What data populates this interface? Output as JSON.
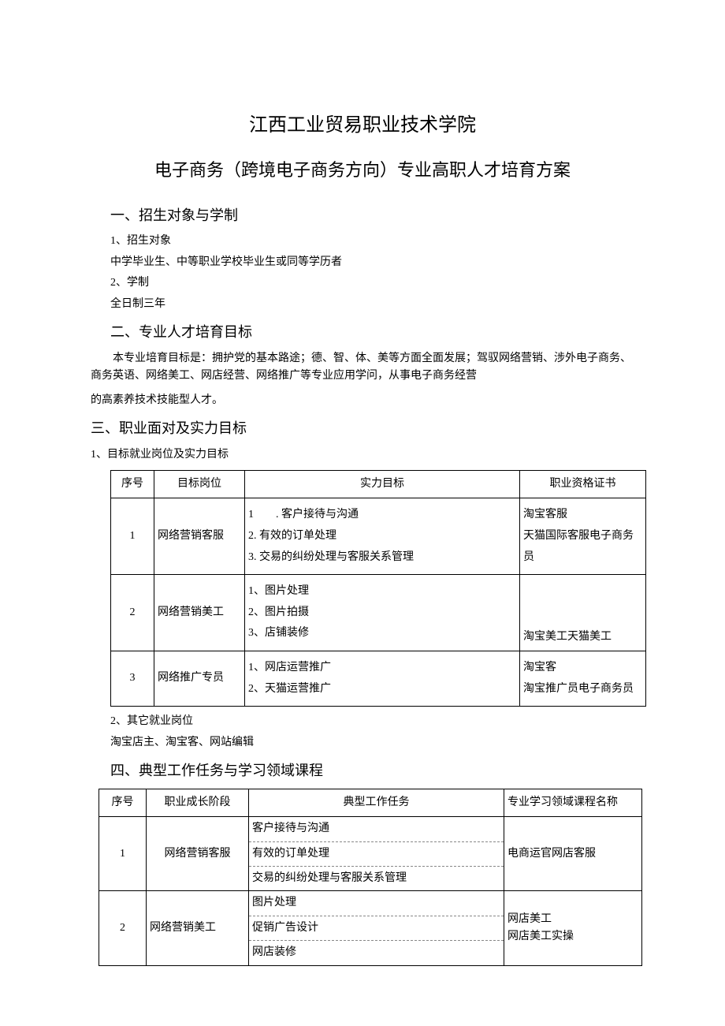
{
  "titles": {
    "main": "江西工业贸易职业技术学院",
    "sub": "电子商务（跨境电子商务方向）专业高职人才培育方案"
  },
  "sections": {
    "s1_heading": "一、招生对象与学制",
    "s1_item1_label": "1、招生对象",
    "s1_item1_text": "中学毕业生、中等职业学校毕业生或同等学历者",
    "s1_item2_label": "2、学制",
    "s1_item2_text": "全日制三年",
    "s2_heading": "二、专业人才培育目标",
    "s2_para1": "本专业培育目标是：拥护党的基本路途；德、智、体、美等方面全面发展；驾驭网络营销、涉外电子商务、商务英语、网络美工、网店经营、网络推广等专业应用学问，从事电子商务经营",
    "s2_para2": "的高素养技术技能型人才。",
    "s3_heading": "三、职业面对及实力目标",
    "s3_item1_label": "1、目标就业岗位及实力目标",
    "s3_item2_label": "2、其它就业岗位",
    "s3_item2_text": "淘宝店主、淘宝客、网站编辑",
    "s4_heading": "四、典型工作任务与学习领域课程"
  },
  "table1": {
    "headers": {
      "seq": "序号",
      "position": "目标岗位",
      "target": "实力目标",
      "cert": "职业资格证书"
    },
    "rows": [
      {
        "seq": "1",
        "position": "网络营销客服",
        "target": "1　　. 客户接待与沟通\n2. 有效的订单处理\n3. 交易的纠纷处理与客服关系管理",
        "cert": "淘宝客服\n天猫国际客服电子商务员"
      },
      {
        "seq": "2",
        "position": "网络营销美工",
        "target": "1、图片处理\n2、图片拍摄\n3、店铺装修",
        "cert": "淘宝美工天猫美工"
      },
      {
        "seq": "3",
        "position": "网络推广专员",
        "target": "1、网店运营推广\n2、天猫运营推广",
        "cert": "淘宝客\n淘宝推广员电子商务员"
      }
    ]
  },
  "table2": {
    "headers": {
      "seq": "序号",
      "stage": "职业成长阶段",
      "task": "典型工作任务",
      "course": "专业学习领域课程名称"
    },
    "rows": [
      {
        "seq": "1",
        "stage": "网络营销客服",
        "tasks": [
          "客户接待与沟通",
          "有效的订单处理",
          "交易的纠纷处理与客服关系管理"
        ],
        "course": "电商运官网店客服"
      },
      {
        "seq": "2",
        "stage": "网络营销美工",
        "tasks": [
          "图片处理",
          "促销广告设计",
          "网店装修"
        ],
        "course": "网店美工\n网店美工实操"
      }
    ]
  }
}
